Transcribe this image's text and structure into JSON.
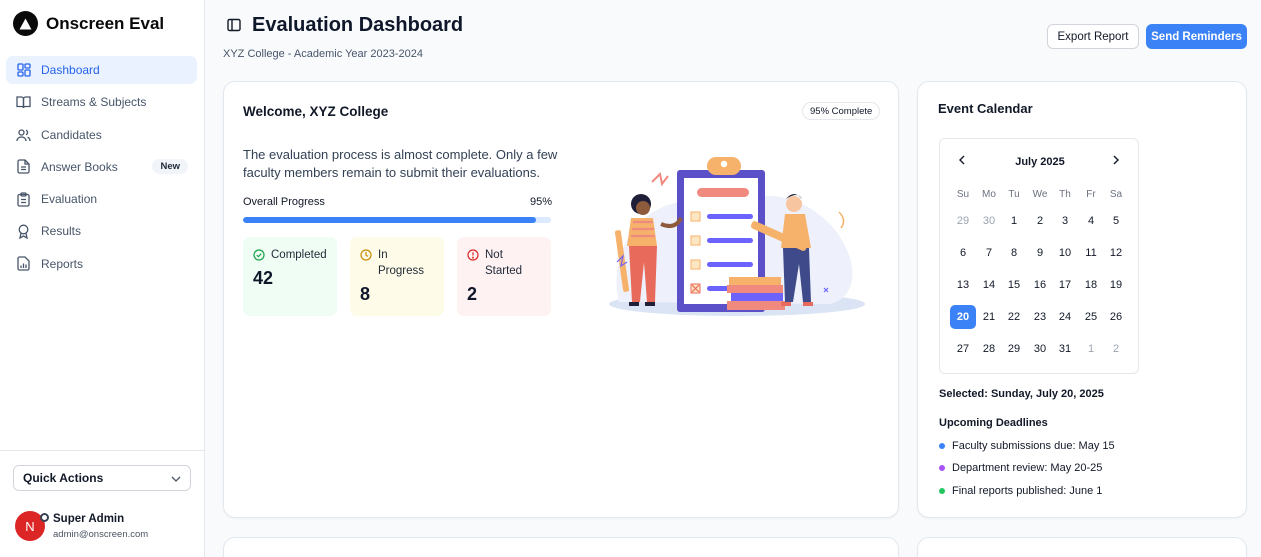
{
  "brand": {
    "name": "Onscreen Eval"
  },
  "nav": {
    "items": [
      {
        "label": "Dashboard",
        "icon": "grid-icon",
        "active": true
      },
      {
        "label": "Streams & Subjects",
        "icon": "book-open-icon"
      },
      {
        "label": "Candidates",
        "icon": "users-icon"
      },
      {
        "label": "Answer Books",
        "icon": "file-text-icon",
        "badge": "New"
      },
      {
        "label": "Evaluation",
        "icon": "clipboard-icon"
      },
      {
        "label": "Results",
        "icon": "award-icon"
      },
      {
        "label": "Reports",
        "icon": "bar-chart-icon"
      }
    ]
  },
  "quick_actions": {
    "label": "Quick Actions"
  },
  "user": {
    "initial": "N",
    "name": "Super Admin",
    "email": "admin@onscreen.com"
  },
  "header": {
    "title": "Evaluation Dashboard",
    "subtitle": "XYZ College - Academic Year 2023-2024",
    "export_label": "Export Report",
    "send_label": "Send Reminders"
  },
  "welcome": {
    "title": "Welcome, XYZ College",
    "badge": "95% Complete",
    "description": "The evaluation process is almost complete. Only a few faculty members remain to submit their evaluations.",
    "progress_label": "Overall Progress",
    "progress_value": "95%",
    "progress_fraction": 0.95,
    "stats": {
      "completed": {
        "label": "Completed",
        "value": "42"
      },
      "in_progress": {
        "label1": "In",
        "label2": "Progress",
        "value": "8"
      },
      "not_started": {
        "label1": "Not",
        "label2": "Started",
        "value": "2"
      }
    }
  },
  "calendar": {
    "title": "Event Calendar",
    "month": "July 2025",
    "weekdays": [
      "Su",
      "Mo",
      "Tu",
      "We",
      "Th",
      "Fr",
      "Sa"
    ],
    "weeks": [
      [
        "29",
        "30",
        "1",
        "2",
        "3",
        "4",
        "5"
      ],
      [
        "6",
        "7",
        "8",
        "9",
        "10",
        "11",
        "12"
      ],
      [
        "13",
        "14",
        "15",
        "16",
        "17",
        "18",
        "19"
      ],
      [
        "20",
        "21",
        "22",
        "23",
        "24",
        "25",
        "26"
      ],
      [
        "27",
        "28",
        "29",
        "30",
        "31",
        "1",
        "2"
      ]
    ],
    "selected_text": "Selected: Sunday, July 20, 2025",
    "deadlines_title": "Upcoming Deadlines",
    "deadlines": [
      {
        "text": "Faculty submissions due: May 15",
        "color": "#3b82f6"
      },
      {
        "text": "Department review: May 20-25",
        "color": "#a855f7"
      },
      {
        "text": "Final reports published: June 1",
        "color": "#22c55e"
      }
    ]
  },
  "colors": {
    "accent": "#3b82f6",
    "selected_day": "#3b82f6"
  }
}
